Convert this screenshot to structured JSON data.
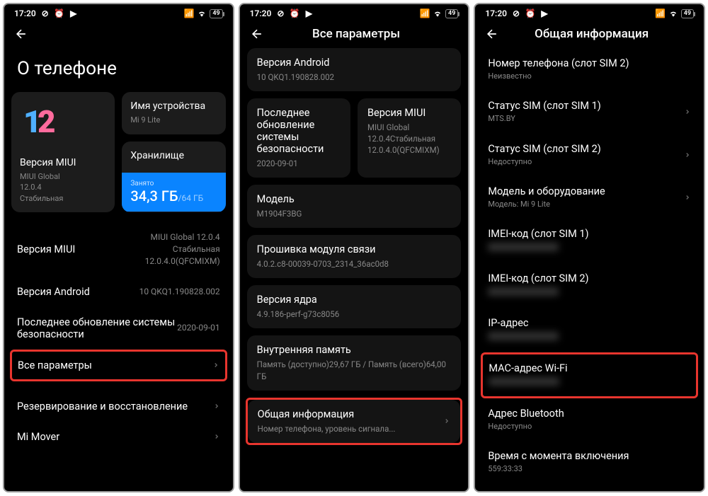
{
  "status": {
    "time": "17:20",
    "battery": "49"
  },
  "screen1": {
    "title": "О телефоне",
    "miui_card": {
      "label": "Версия MIUI",
      "line1": "MIUI Global",
      "line2": "12.0.4",
      "line3": "Стабильная"
    },
    "device_card": {
      "label": "Имя устройства",
      "value": "Mi 9 Lite"
    },
    "storage_card": {
      "label": "Хранилище",
      "used_label": "Занято",
      "used": "34,3 ГБ",
      "total": "/64 ГБ"
    },
    "items": [
      {
        "label": "Версия MIUI",
        "value": "MIUI Global 12.0.4\nСтабильная\n12.0.4.0(QFCMIXM)"
      },
      {
        "label": "Версия Android",
        "value": "10 QKQ1.190828.002"
      },
      {
        "label": "Последнее обновление системы безопасности",
        "value": "2020-09-01"
      },
      {
        "label": "Все параметры",
        "chevron": true,
        "highlight": true
      },
      {
        "label": "Резервирование и восстановление",
        "chevron": true,
        "divider_before": true
      },
      {
        "label": "Mi Mover",
        "chevron": true
      }
    ]
  },
  "screen2": {
    "title": "Все параметры",
    "cards": [
      {
        "label": "Версия Android",
        "value": "10 QKQ1.190828.002"
      }
    ],
    "card_row": [
      {
        "label": "Последнее обновление системы безопасности",
        "value": "2020-09-01"
      },
      {
        "label": "Версия MIUI",
        "value": "MIUI Global 12.0.4Стабильная 12.0.4.0(QFCMIXM)"
      }
    ],
    "cards2": [
      {
        "label": "Модель",
        "value": "M1904F3BG"
      },
      {
        "label": "Прошивка модуля связи",
        "value": "4.0.2.c8-00039-0703_2314_36ac0d8"
      },
      {
        "label": "Версия ядра",
        "value": "4.9.186-perf-g73c8056"
      },
      {
        "label": "Внутренняя память",
        "value": "Память (доступно)29,67 ГБ / Память (всего)64,00 ГБ"
      },
      {
        "label": "Общая информация",
        "value": "Номер телефона, уровень сигнала...",
        "chevron": true,
        "highlight": true
      }
    ]
  },
  "screen3": {
    "title": "Общая информация",
    "items": [
      {
        "label": "Номер телефона (слот SIM 2)",
        "sub": "Неизвестно"
      },
      {
        "label": "Статус SIM (слот SIM 1)",
        "sub": "MTS.BY",
        "chevron": true
      },
      {
        "label": "Статус SIM (слот SIM 2)",
        "sub": "Недоступно",
        "chevron": true
      },
      {
        "label": "Модель и оборудование",
        "sub": "Модель: Mi 9 Lite",
        "chevron": true
      },
      {
        "label": "IMEI-код (слот SIM 1)",
        "blur": true
      },
      {
        "label": "IMEI-код (слот SIM 2)",
        "blur": true
      },
      {
        "label": "IP-адрес",
        "blur": true
      },
      {
        "label": "MAC-адрес Wi-Fi",
        "blur": true,
        "highlight": true
      },
      {
        "label": "Адрес Bluetooth",
        "sub": "Недоступно"
      },
      {
        "label": "Время с момента включения",
        "sub": "559:33:33"
      }
    ]
  }
}
